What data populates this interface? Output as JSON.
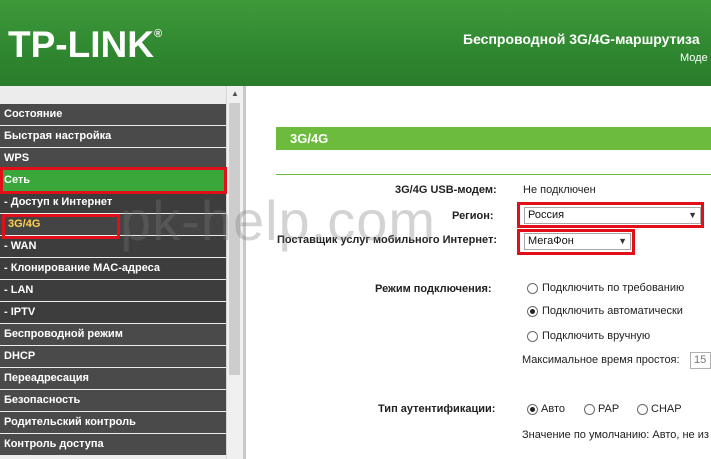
{
  "header": {
    "logo": "TP-LINK",
    "logo_reg": "®",
    "title": "Беспроводной 3G/4G-маршрутиза",
    "model": "Моде"
  },
  "sidebar": {
    "items": [
      {
        "label": "Состояние",
        "type": "top"
      },
      {
        "label": "Быстрая настройка",
        "type": "top"
      },
      {
        "label": "WPS",
        "type": "top"
      },
      {
        "label": "Сеть",
        "type": "active"
      },
      {
        "label": "- Доступ к Интернет",
        "type": "sub"
      },
      {
        "label": "3G/4G",
        "type": "current"
      },
      {
        "label": "- WAN",
        "type": "sub"
      },
      {
        "label": "- Клонирование MAC-адреса",
        "type": "sub"
      },
      {
        "label": "- LAN",
        "type": "sub"
      },
      {
        "label": "- IPTV",
        "type": "sub"
      },
      {
        "label": "Беспроводной режим",
        "type": "top"
      },
      {
        "label": "DHCP",
        "type": "top"
      },
      {
        "label": "Переадресация",
        "type": "top"
      },
      {
        "label": "Безопасность",
        "type": "top"
      },
      {
        "label": "Родительский контроль",
        "type": "top"
      },
      {
        "label": "Контроль доступа",
        "type": "top"
      }
    ]
  },
  "main": {
    "section_title": "3G/4G",
    "modem_label": "3G/4G USB-модем:",
    "modem_value": "Не подключен",
    "region_label": "Регион:",
    "region_value": "Россия",
    "provider_label": "Поставщик услуг мобильного Интернет:",
    "provider_value": "МегаФон",
    "connection_mode_label": "Режим подключения:",
    "connection_modes": [
      {
        "label": "Подключить по требованию",
        "selected": false
      },
      {
        "label": "Подключить автоматически",
        "selected": true
      },
      {
        "label": "Подключить вручную",
        "selected": false
      }
    ],
    "idle_time_label": "Максимальное время простоя:",
    "idle_time_value": "15",
    "auth_label": "Тип аутентификации:",
    "auth_options": [
      {
        "label": "Авто",
        "selected": true
      },
      {
        "label": "PAP",
        "selected": false
      },
      {
        "label": "CHAP",
        "selected": false
      }
    ],
    "default_note": "Значение по умолчанию: Авто, не из"
  },
  "watermark": "pk-help.com",
  "colors": {
    "header_green": "#2f8730",
    "section_green": "#6cbb3c",
    "highlight_red": "#e00f1a",
    "menu_dark": "#4a4a4a",
    "menu_active": "#3aa73a"
  }
}
